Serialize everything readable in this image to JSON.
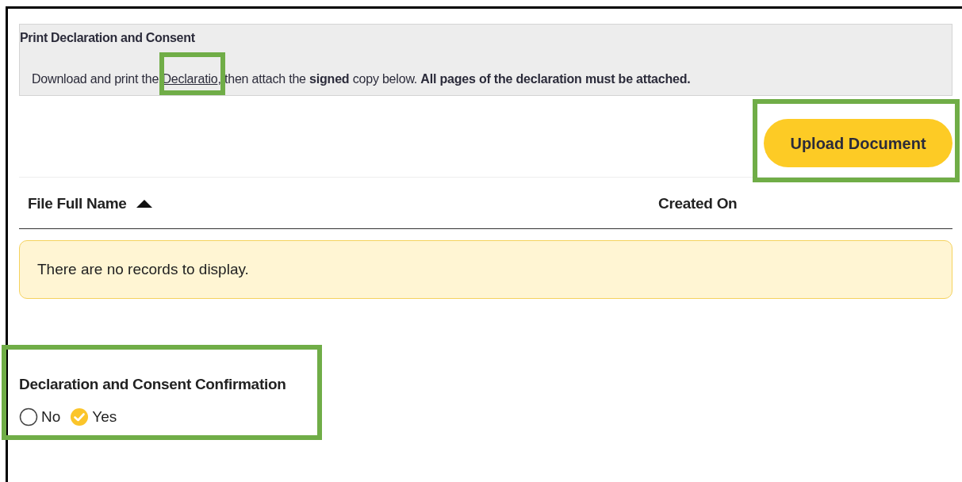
{
  "notice": {
    "title": "Print Declaration and Consent",
    "text_before": "Download and print the",
    "link": "Declaratio",
    "text_after": ", then attach the **signed** copy below. **All pages of the declaration must be attached.**"
  },
  "upload_button": "Upload Document",
  "table": {
    "columns": [
      {
        "label": "File Full Name",
        "sorted": true
      },
      {
        "label": "Created On",
        "sorted": false
      }
    ],
    "empty_message": "There are no records to display."
  },
  "confirmation": {
    "label": "Declaration and Consent Confirmation",
    "options": [
      {
        "label": "No",
        "selected": false
      },
      {
        "label": "Yes",
        "selected": true
      }
    ]
  }
}
